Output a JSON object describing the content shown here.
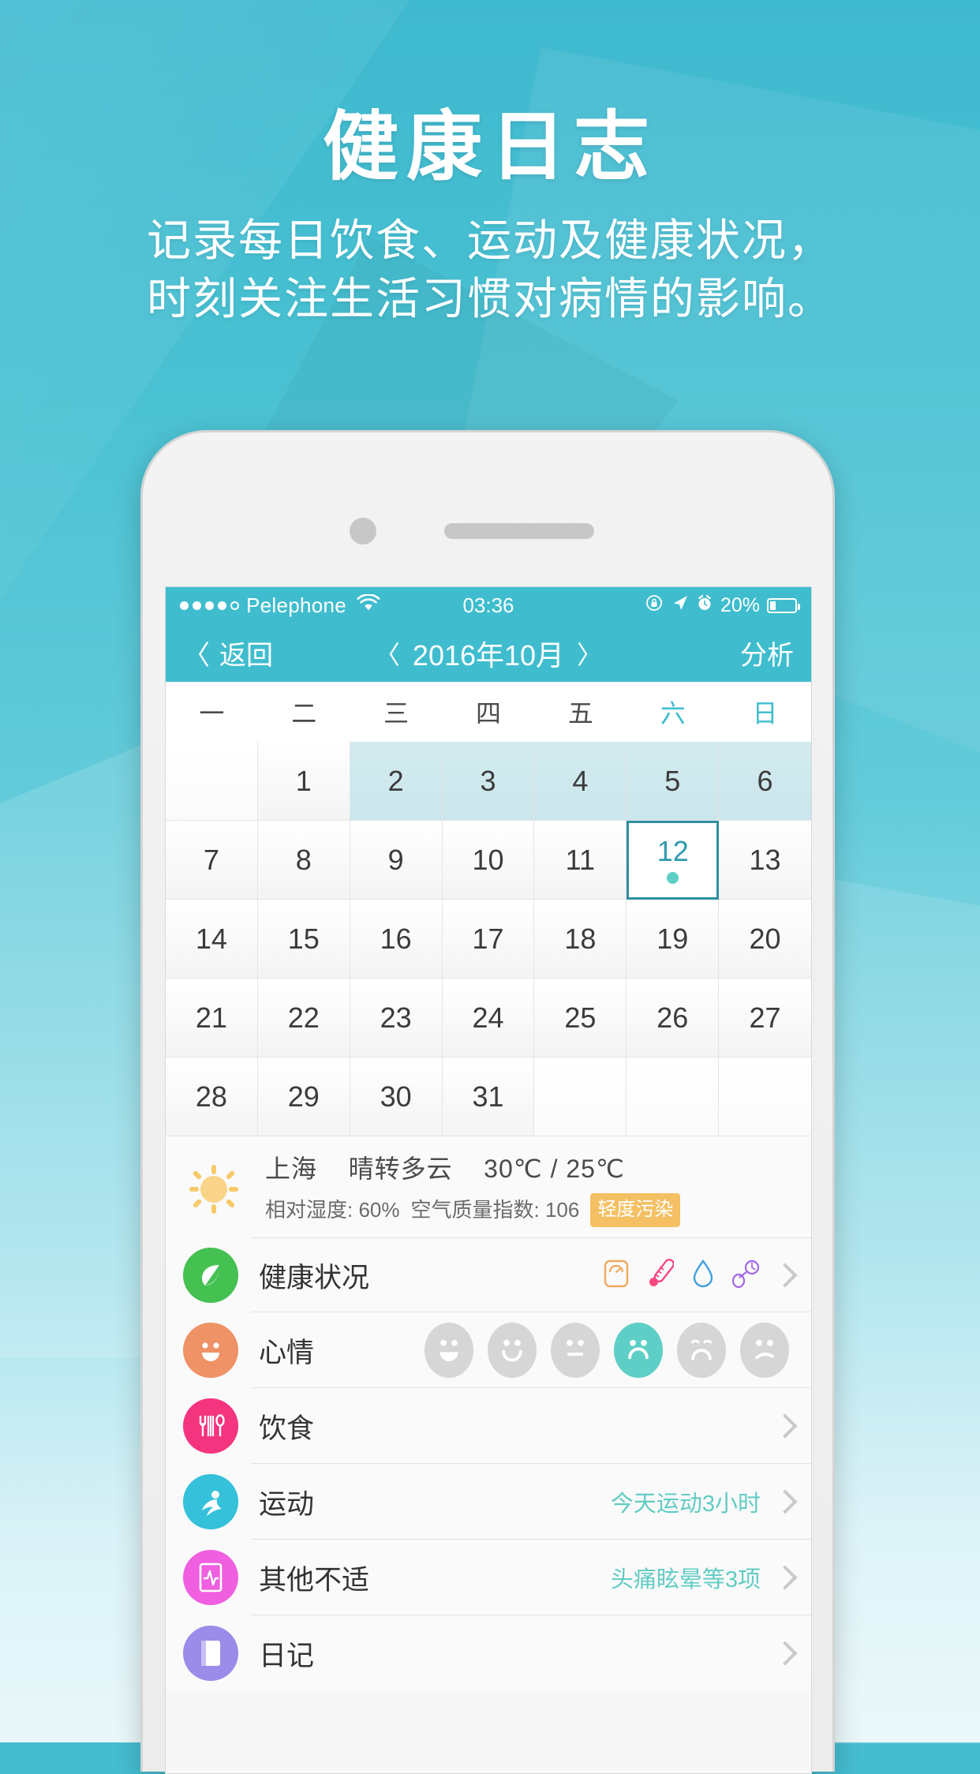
{
  "promo": {
    "title": "健康日志",
    "subtitle_line1": "记录每日饮食、运动及健康状况，",
    "subtitle_line2": "时刻关注生活习惯对病情的影响。"
  },
  "status_bar": {
    "carrier": "Pelephone",
    "signal_dots_filled": 4,
    "signal_dots_total": 5,
    "wifi_icon": "wifi-icon",
    "time": "03:36",
    "rotation_lock_icon": "rotation-lock-icon",
    "location_icon": "location-arrow-icon",
    "alarm_icon": "alarm-clock-icon",
    "battery_percent": "20%",
    "battery_level": 20
  },
  "nav_bar": {
    "back_label": "返回",
    "back_chevron": "〈",
    "prev_month_chevron": "〈",
    "month_title": "2016年10月",
    "next_month_chevron": "〉",
    "right_action": "分析"
  },
  "calendar": {
    "weekdays": [
      "一",
      "二",
      "三",
      "四",
      "五",
      "六",
      "日"
    ],
    "weekend_indexes": [
      5,
      6
    ],
    "leading_blanks": 1,
    "days": [
      1,
      2,
      3,
      4,
      5,
      6,
      7,
      8,
      9,
      10,
      11,
      12,
      13,
      14,
      15,
      16,
      17,
      18,
      19,
      20,
      21,
      22,
      23,
      24,
      25,
      26,
      27,
      28,
      29,
      30,
      31
    ],
    "tinted_days": [
      2,
      3,
      4,
      5,
      6
    ],
    "selected_day": 12,
    "selected_day_has_dot": true,
    "trailing_blanks": 3
  },
  "weather": {
    "icon": "sun-cloud-icon",
    "city": "上海",
    "condition": "晴转多云",
    "temperature": "30℃ / 25℃",
    "humidity": "相对湿度: 60%",
    "aqi": "空气质量指数: 106",
    "aqi_badge": "轻度污染",
    "aqi_badge_color": "#f4c063"
  },
  "list": {
    "health": {
      "label": "健康状况",
      "icon": "leaf-icon",
      "icon_color": "#45c152",
      "mini_icons": [
        {
          "name": "weight-scale-icon",
          "color": "#f0a95e"
        },
        {
          "name": "thermometer-icon",
          "color": "#f6497f"
        },
        {
          "name": "water-drop-icon",
          "color": "#3f9fe0"
        },
        {
          "name": "blood-pressure-icon",
          "color": "#a166e8"
        }
      ]
    },
    "mood": {
      "label": "心情",
      "icon": "smiley-icon",
      "icon_color": "#ef9266",
      "faces": [
        {
          "name": "face-grin",
          "selected": false
        },
        {
          "name": "face-smile",
          "selected": false
        },
        {
          "name": "face-neutral",
          "selected": false
        },
        {
          "name": "face-sad",
          "selected": true
        },
        {
          "name": "face-crying",
          "selected": false
        },
        {
          "name": "face-upset",
          "selected": false
        }
      ],
      "selected_index": 3,
      "selected_color": "#5ecfc6"
    },
    "diet": {
      "label": "饮食",
      "icon": "cutlery-icon",
      "icon_color": "#f5347f",
      "value": ""
    },
    "sport": {
      "label": "运动",
      "icon": "runner-icon",
      "icon_color": "#35c1da",
      "value": "今天运动3小时"
    },
    "other": {
      "label": "其他不适",
      "icon": "ecg-monitor-icon",
      "icon_color": "#ef5fe0",
      "value": "头痛眩晕等3项"
    },
    "diary": {
      "label": "日记",
      "icon": "notebook-icon",
      "icon_color": "#9a8ce8",
      "value": ""
    }
  },
  "theme": {
    "accent": "#3fbdce",
    "value_text": "#62ccc3",
    "selected_border": "#2f8fa0",
    "tint_cell": "#cfe9ee",
    "background_top": "#3fb9cf",
    "background_bottom": "#e9f7fa"
  }
}
